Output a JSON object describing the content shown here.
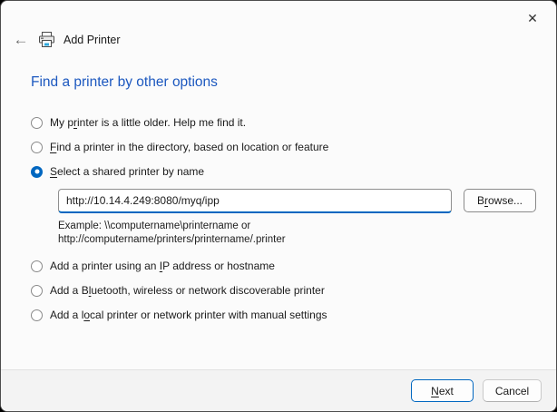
{
  "window": {
    "title": "Add Printer"
  },
  "titlebar": {
    "close_icon": "✕"
  },
  "header": {
    "back_icon": "←",
    "title": "Add Printer"
  },
  "heading": "Find a printer by other options",
  "options": [
    {
      "pre": "My p",
      "accel": "r",
      "post": "inter is a little older. Help me find it.",
      "selected": false
    },
    {
      "pre": "",
      "accel": "F",
      "post": "ind a printer in the directory, based on location or feature",
      "selected": false
    },
    {
      "pre": "",
      "accel": "S",
      "post": "elect a shared printer by name",
      "selected": true
    },
    {
      "pre": "Add a printer using an ",
      "accel": "I",
      "post": "P address or hostname",
      "selected": false
    },
    {
      "pre": "Add a B",
      "accel": "l",
      "post": "uetooth, wireless or network discoverable printer",
      "selected": false
    },
    {
      "pre": "Add a l",
      "accel": "o",
      "post": "cal printer or network printer with manual settings",
      "selected": false
    }
  ],
  "shared": {
    "input_value": "http://10.14.4.249:8080/myq/ipp",
    "browse": {
      "pre": "B",
      "accel": "r",
      "post": "owse..."
    },
    "example_line1": "Example: \\\\computername\\printername or",
    "example_line2": "http://computername/printers/printername/.printer"
  },
  "footer": {
    "next": {
      "pre": "",
      "accel": "N",
      "post": "ext"
    },
    "cancel_label": "Cancel"
  },
  "colors": {
    "accent": "#0067c0",
    "heading_blue": "#1c58bf",
    "footer_bg": "#f3f3f3"
  }
}
